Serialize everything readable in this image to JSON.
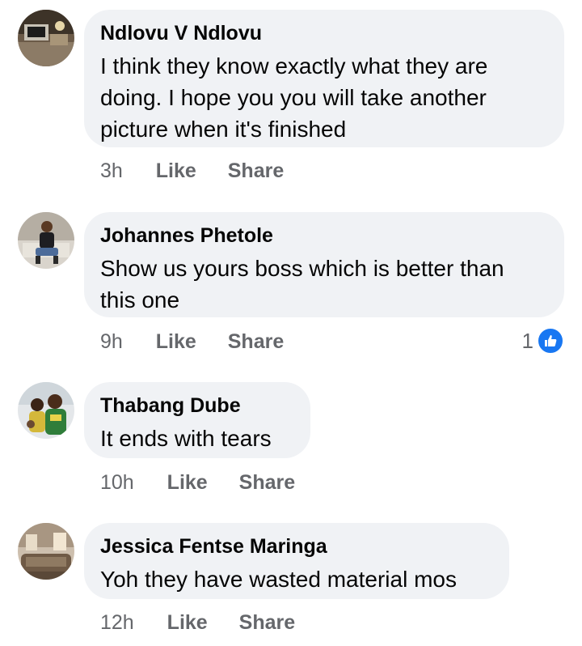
{
  "comments": [
    {
      "author": "Ndlovu V Ndlovu",
      "text": "I think they know exactly what they are\ndoing. I hope you you will take another\npicture when it's finished",
      "time": "3h",
      "like_label": "Like",
      "share_label": "Share",
      "avatar_icon": "avatar-photo-desk-icon"
    },
    {
      "author": "Johannes Phetole",
      "text": "Show us yours boss which is better than\nthis one",
      "time": "9h",
      "like_label": "Like",
      "share_label": "Share",
      "reaction_count": "1",
      "reaction_icon": "thumbs-up-icon",
      "avatar_icon": "avatar-photo-person-sitting-icon"
    },
    {
      "author": "Thabang Dube",
      "text": "It ends with tears",
      "time": "10h",
      "like_label": "Like",
      "share_label": "Share",
      "avatar_icon": "avatar-photo-group-icon"
    },
    {
      "author": "Jessica Fentse Maringa",
      "text": "Yoh they have wasted material mos",
      "time": "12h",
      "like_label": "Like",
      "share_label": "Share",
      "avatar_icon": "avatar-photo-decor-icon"
    }
  ],
  "colors": {
    "bubble": "#f0f2f5",
    "meta_text": "#65676b",
    "like_blue": "#1877f2"
  }
}
